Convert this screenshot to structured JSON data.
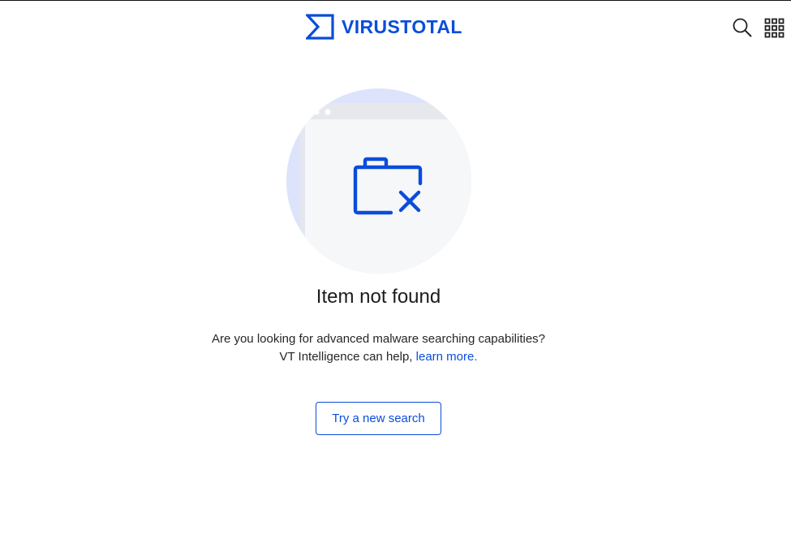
{
  "header": {
    "logo_text": "VIRUSTOTAL",
    "search_icon": "search-icon",
    "apps_icon": "apps-grid-icon"
  },
  "illustration": {
    "icon": "folder-x-icon"
  },
  "main": {
    "title": "Item not found",
    "message_line1": "Are you looking for advanced malware searching capabilities?",
    "message_line2_prefix": "VT Intelligence can help, ",
    "learn_more_link": "learn more",
    "message_line2_suffix": ".",
    "try_button": "Try a new search"
  },
  "colors": {
    "brand_blue": "#0b4dda",
    "circle_bg": "#f3f5fa",
    "window_shadow": "#dfe5fb"
  }
}
